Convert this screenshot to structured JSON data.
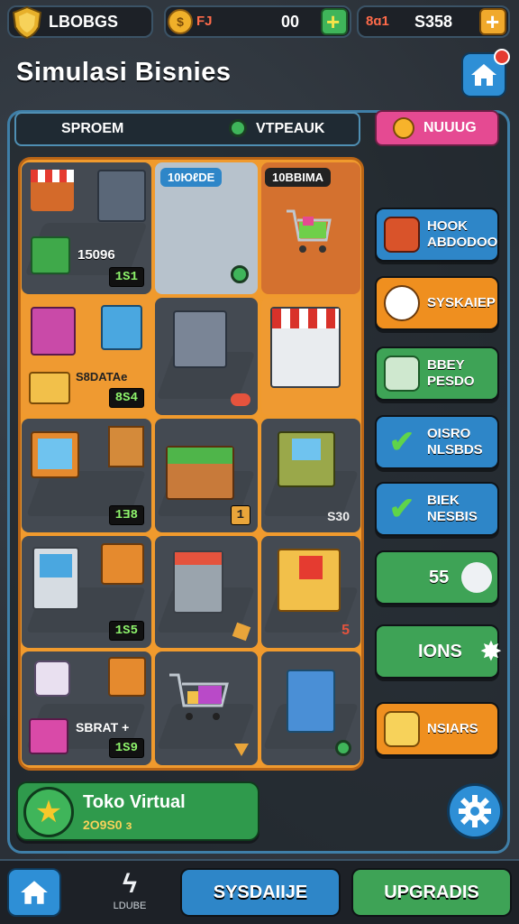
{
  "topbar": {
    "badge_label": "LBOBGS",
    "coins_label": "FJ",
    "coins_value": "00",
    "cash_label": "8ɑ1",
    "cash_value": "S358",
    "add_coins_icon": "plus-icon",
    "add_cash_icon": "plus-icon"
  },
  "title": "Simulasi Bisnies",
  "tabs": {
    "left": "SPROEM",
    "right": "VTPEAUK"
  },
  "pink_button": "NUUUG",
  "grid": {
    "cells": [
      {
        "label": "15096",
        "badge": "1S1"
      },
      {
        "tag": "10ЮℓDE"
      },
      {
        "tag": "10BBIMA"
      },
      {
        "label": "S8DATAe",
        "badge": "8S4"
      },
      {},
      {},
      {
        "badge": "1Ǝ8"
      },
      {
        "badge": "1"
      },
      {
        "badge": "S30"
      },
      {
        "badge": "1S5"
      },
      {},
      {
        "badge": "5"
      },
      {
        "label": "SBRAT +",
        "badge": "1S9"
      },
      {},
      {}
    ]
  },
  "side_buttons": [
    {
      "line1": "HOOK",
      "line2": "ABDODOO",
      "color": "#2e86c8",
      "icon": "box-icon"
    },
    {
      "line1": "SYSKAIEP",
      "line2": "",
      "color": "#ef8f1f",
      "icon": "speech-bubble-icon"
    },
    {
      "line1": "BBEY",
      "line2": "PESDO",
      "color": "#3ea356",
      "icon": "cash-stack-icon"
    },
    {
      "line1": "OISRO",
      "line2": "NLSBDS",
      "color": "#2e86c8",
      "icon": "check-icon"
    },
    {
      "line1": "BIEK",
      "line2": "NESBIS",
      "color": "#2e86c8",
      "icon": "check-icon"
    },
    {
      "line1": "55",
      "line2": "",
      "color": "#3ea356",
      "icon": "handshake-icon"
    },
    {
      "line1": "IONS",
      "line2": "",
      "color": "#3ea356",
      "icon": "star-burst-icon"
    },
    {
      "line1": "NSIARS",
      "line2": "",
      "color": "#ef8f1f",
      "icon": "crate-icon"
    }
  ],
  "shop_card": {
    "name": "Toko Virtual",
    "value": "2O9S0 ɜ"
  },
  "bottom": {
    "nav_label": "LDUBE",
    "btn1": "SYSDAIIJE",
    "btn2": "UPGRADIS"
  }
}
